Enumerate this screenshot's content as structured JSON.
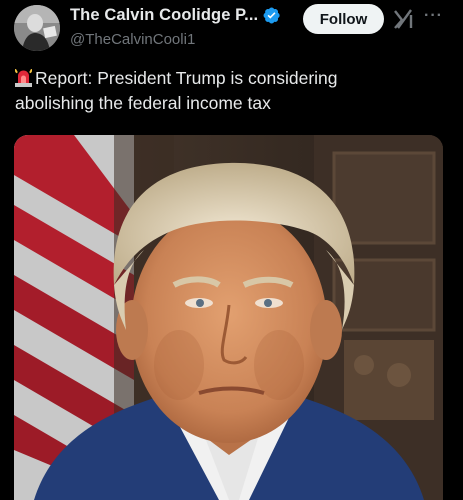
{
  "author": {
    "display_name": "The Calvin Coolidge P...",
    "handle": "@TheCalvinCooli1",
    "avatar_icon": "portrait-avatar",
    "verified_icon": "verified-badge-icon",
    "verified_color": "#1d9bf0"
  },
  "actions": {
    "follow_label": "Follow",
    "grok_icon": "grok-icon",
    "more_icon": "more-dots-icon",
    "more_glyph": "···"
  },
  "post": {
    "emoji_icon": "police-light-emoji",
    "text_line1": "Report: President Trump is considering",
    "text_line2": "abolishing the federal income tax"
  },
  "media": {
    "type": "photo",
    "subject": "portrait"
  },
  "colors": {
    "background": "#000000",
    "text": "#e7e9ea",
    "secondary_text": "#71767b",
    "follow_bg": "#eff3f4"
  }
}
